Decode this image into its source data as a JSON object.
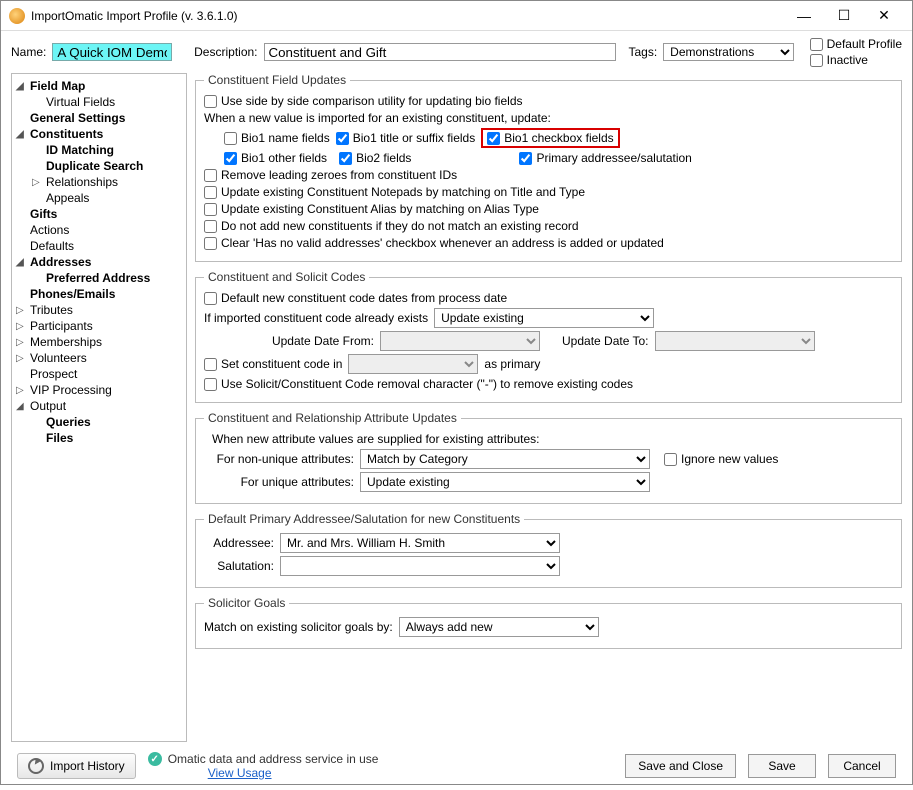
{
  "window": {
    "title": "ImportOmatic Import Profile (v. 3.6.1.0)"
  },
  "top": {
    "name_label": "Name:",
    "name_value": "A Quick IOM Demo",
    "desc_label": "Description:",
    "desc_value": "Constituent and Gift",
    "tags_label": "Tags:",
    "tags_value": "Demonstrations",
    "default_profile": "Default Profile",
    "inactive": "Inactive"
  },
  "nav": {
    "field_map": "Field Map",
    "virtual_fields": "Virtual Fields",
    "general_settings": "General Settings",
    "constituents": "Constituents",
    "id_matching": "ID Matching",
    "duplicate_search": "Duplicate Search",
    "relationships": "Relationships",
    "appeals": "Appeals",
    "gifts": "Gifts",
    "actions": "Actions",
    "defaults": "Defaults",
    "addresses": "Addresses",
    "preferred_address": "Preferred Address",
    "phones_emails": "Phones/Emails",
    "tributes": "Tributes",
    "participants": "Participants",
    "memberships": "Memberships",
    "volunteers": "Volunteers",
    "prospect": "Prospect",
    "vip_processing": "VIP Processing",
    "output": "Output",
    "queries": "Queries",
    "files": "Files"
  },
  "cfu": {
    "legend": "Constituent Field Updates",
    "side_by_side": "Use side by side comparison utility for updating bio fields",
    "when_new": "When a new value is imported for an existing constituent, update:",
    "bio1_name": "Bio1 name fields",
    "bio1_title": "Bio1 title or suffix fields",
    "bio1_checkbox": "Bio1 checkbox fields",
    "bio1_other": "Bio1 other fields",
    "bio2": "Bio2 fields",
    "primary_addr_sal": "Primary addressee/salutation",
    "remove_zeroes": "Remove leading zeroes from constituent IDs",
    "update_notepads": "Update existing Constituent Notepads by matching on Title and Type",
    "update_alias": "Update existing Constituent Alias by matching on Alias Type",
    "no_add_new": "Do not add new constituents if they do not match an existing record",
    "clear_no_valid": "Clear 'Has no valid addresses' checkbox whenever an address is added or updated"
  },
  "csc": {
    "legend": "Constituent and Solicit Codes",
    "default_dates": "Default new constituent code dates from process date",
    "if_exists_label": "If imported constituent code already exists",
    "if_exists_value": "Update existing",
    "update_from": "Update Date From:",
    "update_to": "Update Date To:",
    "set_code_in": "Set constituent code in",
    "as_primary": "as primary",
    "use_solicit": "Use Solicit/Constituent Code removal character (\"-\") to remove existing codes"
  },
  "crau": {
    "legend": "Constituent and Relationship Attribute Updates",
    "when_new_attrs": "When new attribute values are supplied for existing attributes:",
    "non_unique_label": "For non-unique attributes:",
    "non_unique_value": "Match by Category",
    "ignore_new": "Ignore new values",
    "unique_label": "For unique attributes:",
    "unique_value": "Update existing"
  },
  "dpas": {
    "legend": "Default Primary Addressee/Salutation for new Constituents",
    "addressee_label": "Addressee:",
    "addressee_value": "Mr. and Mrs. William H. Smith",
    "salutation_label": "Salutation:",
    "salutation_value": ""
  },
  "sg": {
    "legend": "Solicitor Goals",
    "match_label": "Match on existing solicitor goals by:",
    "match_value": "Always add new"
  },
  "footer": {
    "import_history": "Import History",
    "service_status": "Omatic data and address service in use",
    "view_usage": "View Usage",
    "save_close": "Save and Close",
    "save": "Save",
    "cancel": "Cancel"
  }
}
